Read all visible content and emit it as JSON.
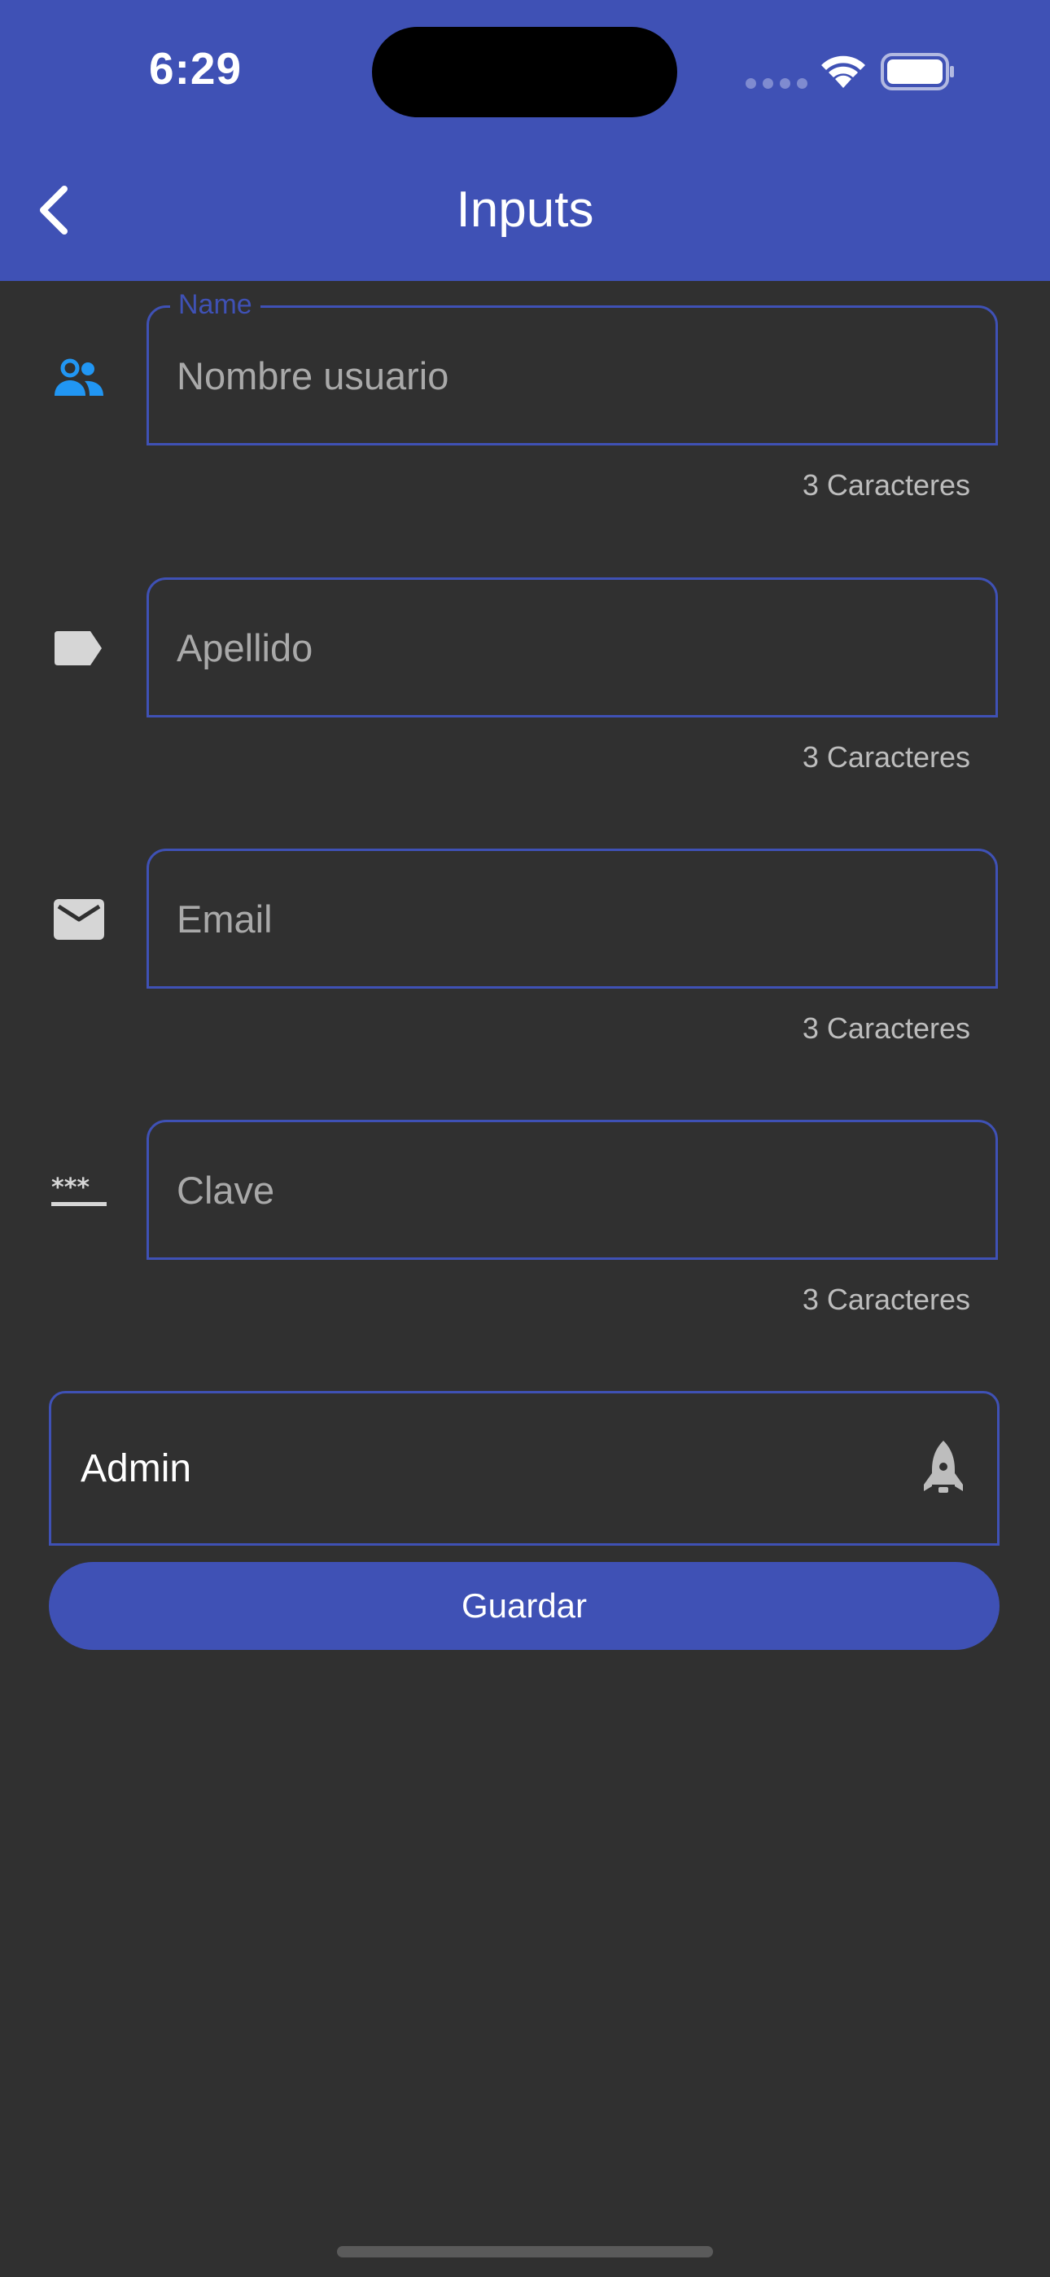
{
  "status_bar": {
    "time": "6:29"
  },
  "app_bar": {
    "title": "Inputs",
    "back_icon": "chevron-left-icon",
    "background": "#3F51B5"
  },
  "form": {
    "fields": [
      {
        "label": "Name",
        "placeholder": "Nombre usuario",
        "value": "",
        "helper": "3 Caracteres",
        "icon": "people-icon",
        "icon_color": "#2196F3"
      },
      {
        "label": "",
        "placeholder": "Apellido",
        "value": "",
        "helper": "3 Caracteres",
        "icon": "label-tag-icon",
        "icon_color": "#d6d6d6"
      },
      {
        "label": "",
        "placeholder": "Email",
        "value": "",
        "helper": "3 Caracteres",
        "icon": "email-icon",
        "icon_color": "#d6d6d6"
      },
      {
        "label": "",
        "placeholder": "Clave",
        "value": "",
        "helper": "3 Caracteres",
        "icon": "password-icon",
        "icon_color": "#d6d6d6"
      }
    ],
    "role_select": {
      "value": "Admin",
      "icon": "rocket-icon"
    },
    "save_label": "Guardar"
  },
  "colors": {
    "primary": "#3F51B5",
    "background": "#303030",
    "accent_icon": "#2196F3"
  }
}
